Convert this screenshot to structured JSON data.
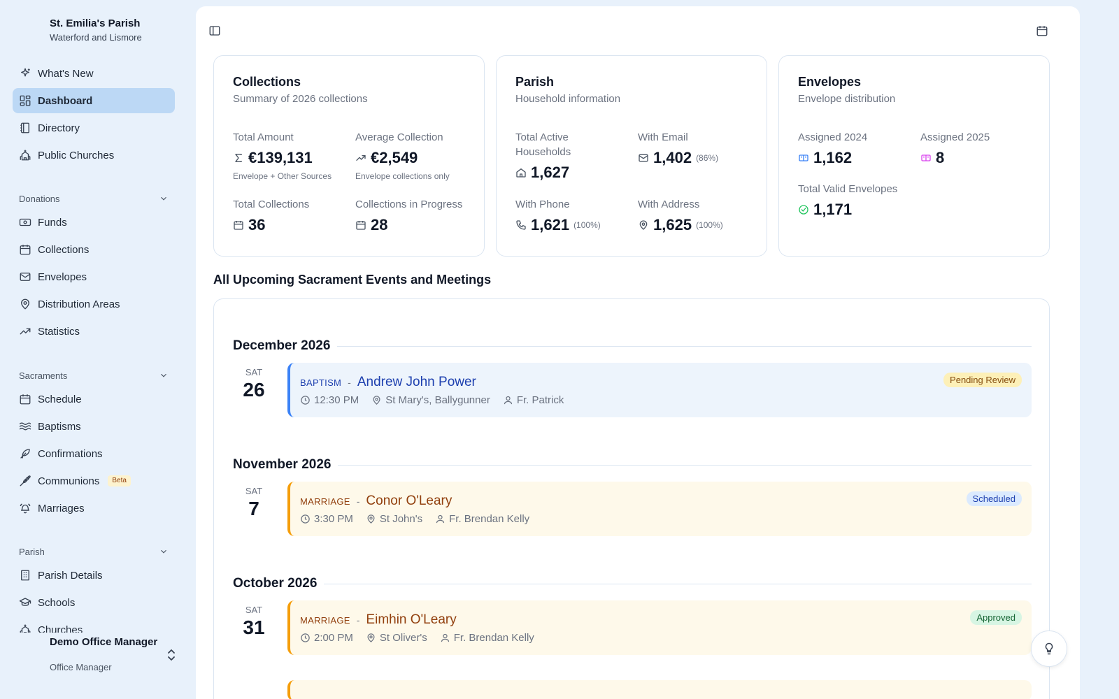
{
  "parish": {
    "name": "St. Emilia's Parish",
    "diocese": "Waterford and Lismore"
  },
  "nav": {
    "top": [
      {
        "label": "What's New",
        "icon": "sparkles-icon"
      },
      {
        "label": "Dashboard",
        "icon": "dashboard-icon",
        "active": true
      },
      {
        "label": "Directory",
        "icon": "book-icon"
      },
      {
        "label": "Public Churches",
        "icon": "church-icon"
      }
    ],
    "donations": {
      "title": "Donations",
      "items": [
        {
          "label": "Funds",
          "icon": "banknote-icon"
        },
        {
          "label": "Collections",
          "icon": "calendar-icon"
        },
        {
          "label": "Envelopes",
          "icon": "mail-icon"
        },
        {
          "label": "Distribution Areas",
          "icon": "map-pin-icon"
        },
        {
          "label": "Statistics",
          "icon": "trending-up-icon"
        }
      ]
    },
    "sacraments": {
      "title": "Sacraments",
      "items": [
        {
          "label": "Schedule",
          "icon": "calendar-icon"
        },
        {
          "label": "Baptisms",
          "icon": "waves-icon"
        },
        {
          "label": "Confirmations",
          "icon": "feather-icon"
        },
        {
          "label": "Communions",
          "icon": "wheat-icon",
          "badge": "Beta"
        },
        {
          "label": "Marriages",
          "icon": "bells-icon"
        }
      ]
    },
    "parish": {
      "title": "Parish",
      "items": [
        {
          "label": "Parish Details",
          "icon": "building-icon"
        },
        {
          "label": "Schools",
          "icon": "graduation-cap-icon"
        },
        {
          "label": "Churches",
          "icon": "church-icon"
        }
      ]
    }
  },
  "user": {
    "name": "Demo Office Manager",
    "role": "Office Manager"
  },
  "cards": {
    "collections": {
      "title": "Collections",
      "subtitle": "Summary of 2026 collections",
      "total_amount": {
        "label": "Total Amount",
        "value": "€139,131",
        "note": "Envelope + Other Sources",
        "icon": "sigma-icon"
      },
      "average": {
        "label": "Average Collection",
        "value": "€2,549",
        "note": "Envelope collections only",
        "icon": "trending-up-icon"
      },
      "total_collections": {
        "label": "Total Collections",
        "value": "36",
        "icon": "calendar-icon"
      },
      "in_progress": {
        "label": "Collections in Progress",
        "value": "28",
        "icon": "calendar-icon"
      }
    },
    "parish": {
      "title": "Parish",
      "subtitle": "Household information",
      "households": {
        "label_line1": "Total Active",
        "label_line2": "Households",
        "value": "1,627",
        "icon": "home-icon"
      },
      "email": {
        "label": "With Email",
        "value": "1,402",
        "pct": "(86%)",
        "icon": "mail-icon"
      },
      "phone": {
        "label": "With Phone",
        "value": "1,621",
        "pct": "(100%)",
        "icon": "phone-icon"
      },
      "address": {
        "label": "With Address",
        "value": "1,625",
        "pct": "(100%)",
        "icon": "map-pin-icon"
      }
    },
    "envelopes": {
      "title": "Envelopes",
      "subtitle": "Envelope distribution",
      "assigned_2024": {
        "label": "Assigned 2024",
        "value": "1,162",
        "icon": "ticket-icon",
        "color": "#3b82f6"
      },
      "assigned_2025": {
        "label": "Assigned 2025",
        "value": "8",
        "icon": "ticket-icon",
        "color": "#d946ef"
      },
      "valid": {
        "label": "Total Valid Envelopes",
        "value": "1,171",
        "icon": "check-circle-icon",
        "color": "#22c55e"
      }
    }
  },
  "events_section": {
    "title": "All Upcoming Sacrament Events and Meetings",
    "months": [
      {
        "label": "December 2026",
        "events": [
          {
            "dow": "SAT",
            "day": "26",
            "type": "BAPTISM",
            "name": "Andrew John Power",
            "time": "12:30 PM",
            "location": "St Mary's, Ballygunner",
            "priest": "Fr. Patrick",
            "status": "Pending Review",
            "color": "blue"
          }
        ]
      },
      {
        "label": "November 2026",
        "events": [
          {
            "dow": "SAT",
            "day": "7",
            "type": "MARRIAGE",
            "name": "Conor O'Leary",
            "time": "3:30 PM",
            "location": "St John's",
            "priest": "Fr. Brendan Kelly",
            "status": "Scheduled",
            "color": "amber"
          }
        ]
      },
      {
        "label": "October 2026",
        "events": [
          {
            "dow": "SAT",
            "day": "31",
            "type": "MARRIAGE",
            "name": "Eimhin O'Leary",
            "time": "2:00 PM",
            "location": "St Oliver's",
            "priest": "Fr. Brendan Kelly",
            "status": "Approved",
            "color": "amber"
          }
        ]
      }
    ]
  },
  "colors": {
    "accent": "#3b82f6",
    "marriage": "#f59e0b",
    "active_nav": "#bcd8f5"
  }
}
